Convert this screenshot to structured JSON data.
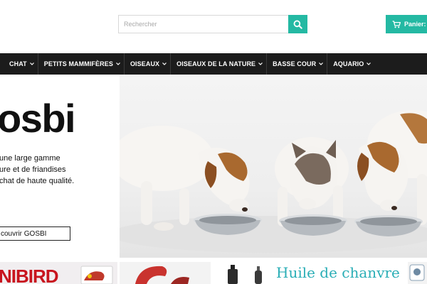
{
  "search": {
    "placeholder": "Rechercher"
  },
  "cart": {
    "label": "Panier:"
  },
  "nav": {
    "items": [
      {
        "label": "CHAT"
      },
      {
        "label": "PETITS MAMMIFÈRES"
      },
      {
        "label": "OISEAUX"
      },
      {
        "label": "OISEAUX DE LA NATURE"
      },
      {
        "label": "BASSE COUR"
      },
      {
        "label": "AQUARIO"
      }
    ]
  },
  "hero": {
    "brand": "osbi",
    "lines": [
      "une large gamme",
      "ure et de friandises",
      " chat de haute qualité."
    ],
    "cta": "couvrir GOSBI"
  },
  "promos": {
    "unibird": "NIBIRD",
    "hemp_title": "Huile de chanvre"
  },
  "colors": {
    "accent": "#24b9a3",
    "nav_bg": "#1c1c1c",
    "hemp": "#2aaeb6",
    "unibird": "#c8141e"
  }
}
